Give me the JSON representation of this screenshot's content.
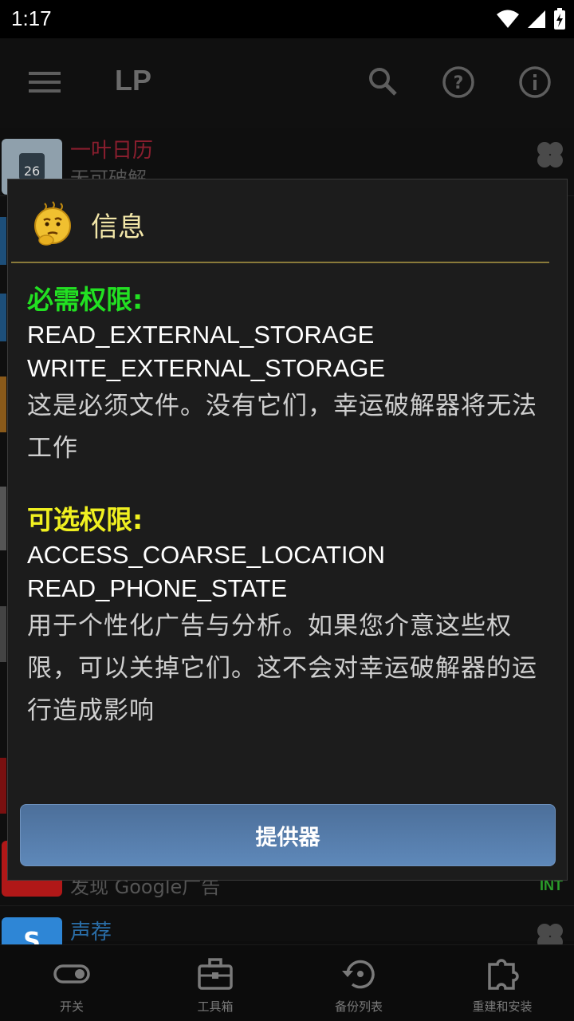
{
  "status_bar": {
    "time": "1:17"
  },
  "app_bar": {
    "title": "LP"
  },
  "background_list": {
    "items": [
      {
        "title": "一叶日历",
        "subtitle": "无可破解",
        "title_color": "#b3263a",
        "icon_text": "26"
      },
      {
        "title": "发现 Google广告",
        "subtitle": "发现 Google广告",
        "badge": "INT"
      },
      {
        "title": "声荐",
        "subtitle": "",
        "title_color": "#3b8fd9",
        "icon_text": "S"
      }
    ]
  },
  "dialog": {
    "title": "信息",
    "required": {
      "heading": "必需权限:",
      "permissions": [
        "READ_EXTERNAL_STORAGE",
        "WRITE_EXTERNAL_STORAGE"
      ],
      "description": "这是必须文件。没有它们，幸运破解器将无法工作"
    },
    "optional": {
      "heading": "可选权限:",
      "permissions": [
        "ACCESS_COARSE_LOCATION",
        "READ_PHONE_STATE"
      ],
      "description": "用于个性化广告与分析。如果您介意这些权限，可以关掉它们。这不会对幸运破解器的运行造成影响"
    },
    "button_label": "提供器"
  },
  "bottom_nav": {
    "items": [
      {
        "label": "开关",
        "icon": "toggle-icon"
      },
      {
        "label": "工具箱",
        "icon": "toolbox-icon"
      },
      {
        "label": "备份列表",
        "icon": "backup-restore-icon"
      },
      {
        "label": "重建和安装",
        "icon": "puzzle-icon"
      }
    ]
  },
  "colors": {
    "required_heading": "#22e022",
    "optional_heading": "#f0f020",
    "dialog_title": "#f2e6a8",
    "button": "#5a7fae"
  }
}
